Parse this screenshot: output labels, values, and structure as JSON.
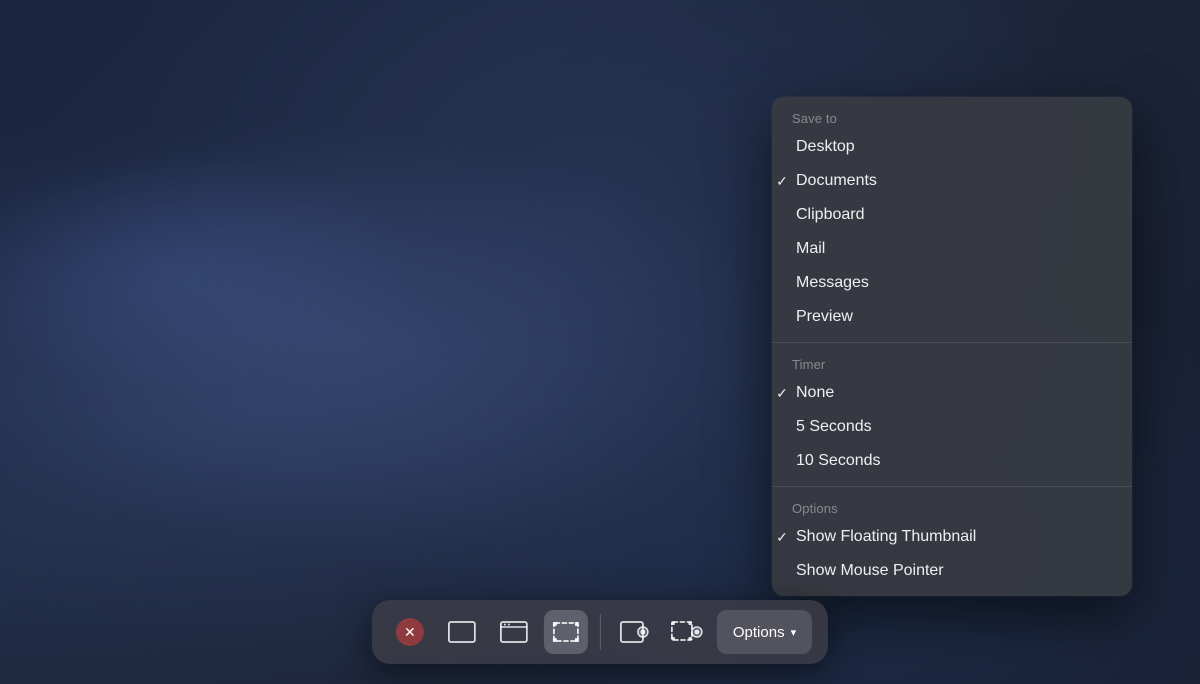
{
  "desktop": {
    "background": "macOS dark desktop"
  },
  "toolbar": {
    "buttons": [
      {
        "id": "close",
        "label": "✕",
        "type": "close"
      },
      {
        "id": "fullscreen",
        "label": "fullscreen-icon",
        "active": false
      },
      {
        "id": "window",
        "label": "window-icon",
        "active": false
      },
      {
        "id": "selection",
        "label": "selection-icon",
        "active": true
      },
      {
        "id": "fullscreen-video",
        "label": "fullscreen-video-icon",
        "active": false
      },
      {
        "id": "selection-video",
        "label": "selection-video-icon",
        "active": false
      }
    ],
    "options_label": "Options",
    "options_chevron": "▾"
  },
  "dropdown": {
    "sections": [
      {
        "id": "save-to",
        "label": "Save to",
        "items": [
          {
            "id": "desktop",
            "text": "Desktop",
            "checked": false
          },
          {
            "id": "documents",
            "text": "Documents",
            "checked": true
          },
          {
            "id": "clipboard",
            "text": "Clipboard",
            "checked": false
          },
          {
            "id": "mail",
            "text": "Mail",
            "checked": false
          },
          {
            "id": "messages",
            "text": "Messages",
            "checked": false
          },
          {
            "id": "preview",
            "text": "Preview",
            "checked": false
          }
        ]
      },
      {
        "id": "timer",
        "label": "Timer",
        "items": [
          {
            "id": "none",
            "text": "None",
            "checked": true
          },
          {
            "id": "5-seconds",
            "text": "5 Seconds",
            "checked": false
          },
          {
            "id": "10-seconds",
            "text": "10 Seconds",
            "checked": false
          }
        ]
      },
      {
        "id": "options",
        "label": "Options",
        "items": [
          {
            "id": "show-floating-thumbnail",
            "text": "Show Floating Thumbnail",
            "checked": true
          },
          {
            "id": "show-mouse-pointer",
            "text": "Show Mouse Pointer",
            "checked": false
          }
        ]
      }
    ]
  }
}
